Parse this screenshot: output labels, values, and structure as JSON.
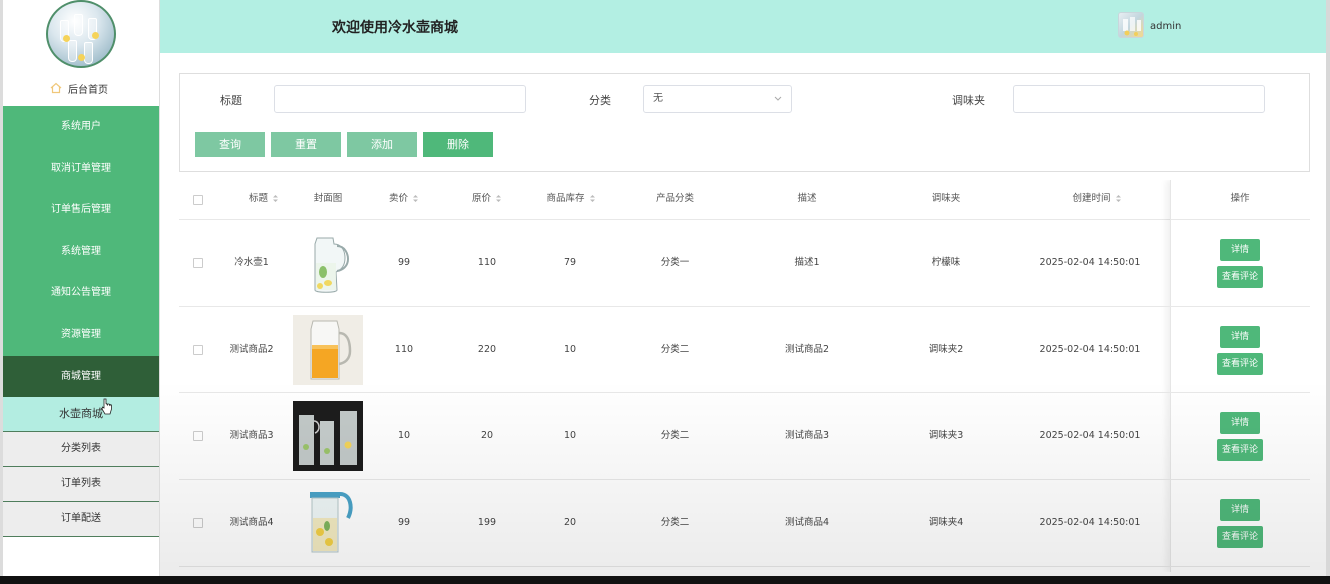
{
  "sidebar": {
    "home_label": "后台首页",
    "menu": [
      {
        "label": "系统用户"
      },
      {
        "label": "取消订单管理"
      },
      {
        "label": "订单售后管理"
      },
      {
        "label": "系统管理"
      },
      {
        "label": "通知公告管理"
      },
      {
        "label": "资源管理"
      },
      {
        "label": "商城管理"
      }
    ],
    "submenu": [
      {
        "label": "水壶商城"
      },
      {
        "label": "分类列表"
      },
      {
        "label": "订单列表"
      },
      {
        "label": "订单配送"
      }
    ]
  },
  "header": {
    "title": "欢迎使用冷水壶商城",
    "user": "admin"
  },
  "search": {
    "title_label": "标题",
    "title_value": "",
    "category_label": "分类",
    "category_value": "无",
    "flavor_label": "调味夹",
    "flavor_value": "",
    "buttons": {
      "query": "查询",
      "reset": "重置",
      "add": "添加",
      "delete": "删除"
    }
  },
  "table": {
    "columns": {
      "title": "标题",
      "cover": "封面图",
      "price": "卖价",
      "original_price": "原价",
      "stock": "商品库存",
      "category": "产品分类",
      "description": "描述",
      "flavor": "调味夹",
      "created": "创建时间",
      "ops": "操作"
    },
    "rows": [
      {
        "title": "冷水壶1",
        "price": "99",
        "original_price": "110",
        "stock": "79",
        "category": "分类一",
        "description": "描述1",
        "flavor": "柠檬味",
        "created": "2025-02-04 14:50:01"
      },
      {
        "title": "测试商品2",
        "price": "110",
        "original_price": "220",
        "stock": "10",
        "category": "分类二",
        "description": "测试商品2",
        "flavor": "调味夹2",
        "created": "2025-02-04 14:50:01"
      },
      {
        "title": "测试商品3",
        "price": "10",
        "original_price": "20",
        "stock": "10",
        "category": "分类二",
        "description": "测试商品3",
        "flavor": "调味夹3",
        "created": "2025-02-04 14:50:01"
      },
      {
        "title": "测试商品4",
        "price": "99",
        "original_price": "199",
        "stock": "20",
        "category": "分类二",
        "description": "测试商品4",
        "flavor": "调味夹4",
        "created": "2025-02-04 14:50:01"
      }
    ],
    "op_detail": "详情",
    "op_review": "查看评论"
  },
  "colors": {
    "accent": "#4fb87a",
    "accent_light": "#7ec8a2",
    "menu_active": "#2f5f38",
    "header_bg": "#b3efe3"
  }
}
